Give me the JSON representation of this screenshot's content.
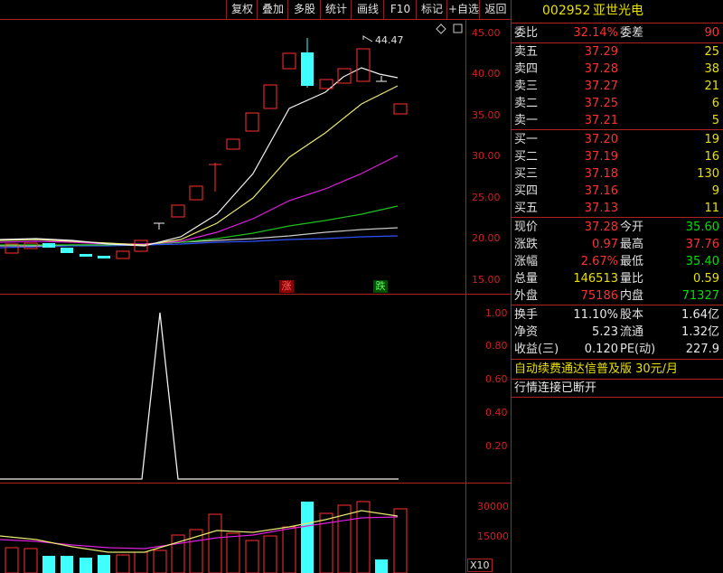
{
  "toolbar": {
    "items": [
      "复权",
      "叠加",
      "多股",
      "统计",
      "画线",
      "F10",
      "标记",
      "+自选",
      "返回"
    ]
  },
  "main_chart": {
    "axis": [
      "45.00",
      "40.00",
      "35.00",
      "30.00",
      "25.00",
      "20.00",
      "15.00"
    ],
    "high_label": "44.47",
    "marker_up": "涨",
    "marker_down": "跌"
  },
  "indicator": {
    "axis": [
      "1.00",
      "0.80",
      "0.60",
      "0.40",
      "0.20"
    ]
  },
  "volume": {
    "axis": [
      "30000",
      "15000"
    ],
    "unit": "X10"
  },
  "quote": {
    "code": "002952",
    "name": "亚世光电",
    "weibi_label": "委比",
    "weibi": "32.14%",
    "weicha_label": "委差",
    "weicha": "90",
    "asks": [
      {
        "label": "卖五",
        "price": "37.29",
        "vol": "25"
      },
      {
        "label": "卖四",
        "price": "37.28",
        "vol": "38"
      },
      {
        "label": "卖三",
        "price": "37.27",
        "vol": "21"
      },
      {
        "label": "卖二",
        "price": "37.25",
        "vol": "6"
      },
      {
        "label": "卖一",
        "price": "37.21",
        "vol": "5"
      }
    ],
    "bids": [
      {
        "label": "买一",
        "price": "37.20",
        "vol": "19"
      },
      {
        "label": "买二",
        "price": "37.19",
        "vol": "16"
      },
      {
        "label": "买三",
        "price": "37.18",
        "vol": "130"
      },
      {
        "label": "买四",
        "price": "37.16",
        "vol": "9"
      },
      {
        "label": "买五",
        "price": "37.13",
        "vol": "11"
      }
    ],
    "stats": [
      {
        "l1": "现价",
        "v1": "37.28",
        "l2": "今开",
        "v2": "35.60",
        "c1": "red",
        "c2": "green"
      },
      {
        "l1": "涨跌",
        "v1": "0.97",
        "l2": "最高",
        "v2": "37.76",
        "c1": "red",
        "c2": "red"
      },
      {
        "l1": "涨幅",
        "v1": "2.67%",
        "l2": "最低",
        "v2": "35.40",
        "c1": "red",
        "c2": "green"
      },
      {
        "l1": "总量",
        "v1": "146513",
        "l2": "量比",
        "v2": "0.59",
        "c1": "yellow",
        "c2": "yellow"
      },
      {
        "l1": "外盘",
        "v1": "75186",
        "l2": "内盘",
        "v2": "71327",
        "c1": "red",
        "c2": "green"
      }
    ],
    "extra": [
      {
        "l1": "换手",
        "v1": "11.10%",
        "l2": "股本",
        "v2": "1.64亿"
      },
      {
        "l1": "净资",
        "v1": "5.23",
        "l2": "流通",
        "v2": "1.32亿"
      },
      {
        "l1": "收益(三)",
        "v1": "0.120",
        "l2": "PE(动)",
        "v2": "227.9"
      }
    ],
    "ad": "自动续费通达信普及版  30元/月",
    "status": "行情连接已断开"
  }
}
